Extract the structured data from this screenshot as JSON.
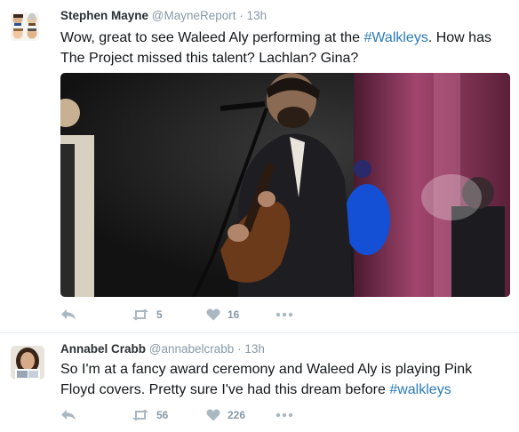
{
  "tweets": [
    {
      "name": "Stephen Mayne",
      "handle": "@MayneReport",
      "time": "13h",
      "text_parts": [
        "Wow, great to see Waleed Aly performing at the ",
        "#Walkleys",
        ". How has The Project missed this talent? Lachlan? Gina?"
      ],
      "retweets": "5",
      "likes": "16",
      "icons": [
        "reply-icon",
        "retweet-icon",
        "heart-icon",
        "more-icon"
      ]
    },
    {
      "name": "Annabel Crabb",
      "handle": "@annabelcrabb",
      "time": "13h",
      "text_parts": [
        "So I'm at a fancy award ceremony and Waleed Aly is playing Pink Floyd covers. Pretty sure I've had this dream before ",
        "#walkleys"
      ],
      "retweets": "56",
      "likes": "226",
      "icons": [
        "reply-icon",
        "retweet-icon",
        "heart-icon",
        "more-icon"
      ]
    }
  ],
  "separator": "·",
  "colors": {
    "name": "#292f33",
    "meta": "#8899a6",
    "hashtag": "#2b7bb9",
    "divider": "#e1e8ed"
  }
}
